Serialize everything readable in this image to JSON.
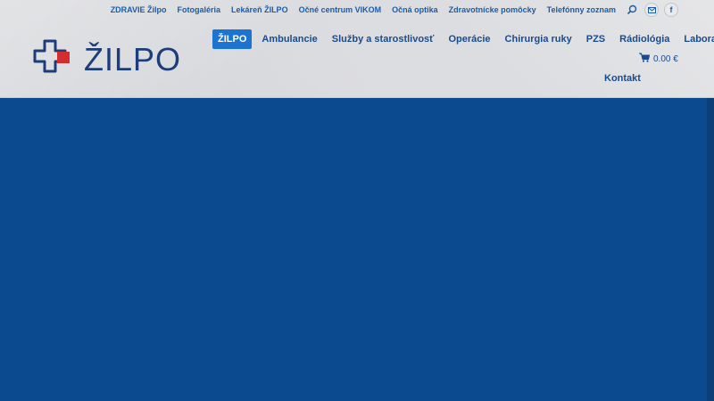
{
  "topbar": {
    "links": [
      "ZDRAVIE Žilpo",
      "Fotogaléria",
      "Lekáreň ŽILPO",
      "Očné centrum VIKOM",
      "Očná optika",
      "Zdravotnícke pomôcky",
      "Telefónny zoznam"
    ],
    "facebook_glyph": "f"
  },
  "logo": {
    "text": "ŽILPO"
  },
  "nav": {
    "items": [
      "ŽILPO",
      "Ambulancie",
      "Služby a starostlivosť",
      "Operácie",
      "Chirurgia ruky",
      "PZS",
      "Rádiológia",
      "Laboratórium"
    ],
    "kontakt": "Kontakt"
  },
  "cart": {
    "value": "0.00 €"
  },
  "colors": {
    "brand_blue": "#0b4a8f",
    "accent": "#1b74cf",
    "logo_red": "#d32d2f",
    "logo_navy": "#1d3d7a"
  },
  "icons": [
    "search-icon",
    "mail-icon",
    "facebook-icon",
    "cart-icon",
    "logo-cross-icon"
  ]
}
